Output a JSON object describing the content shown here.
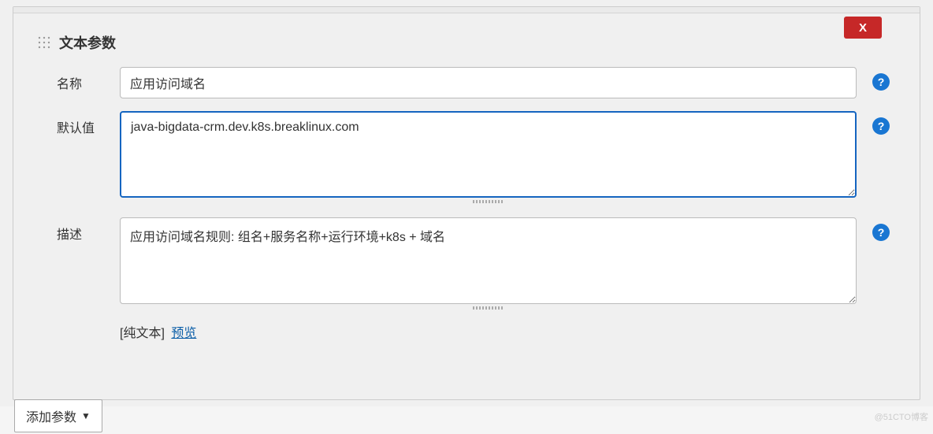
{
  "panel": {
    "close_label": "X",
    "section_title": "文本参数"
  },
  "fields": {
    "name": {
      "label": "名称",
      "value": "应用访问域名"
    },
    "default_value": {
      "label": "默认值",
      "value": "java-bigdata-crm.dev.k8s.breaklinux.com"
    },
    "description": {
      "label": "描述",
      "value": "应用访问域名规则: 组名+服务名称+运行环境+k8s + 域名",
      "plain_text_label": "[纯文本]",
      "preview_label": "预览"
    }
  },
  "actions": {
    "add_param_label": "添加参数",
    "caret": "▼"
  },
  "help_icon": "?",
  "watermark": "@51CTO博客"
}
